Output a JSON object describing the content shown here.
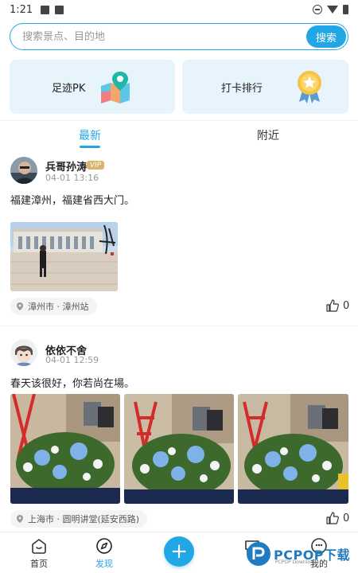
{
  "status_bar": {
    "time": "1:21"
  },
  "search": {
    "placeholder": "搜索景点、目的地",
    "button": "搜索"
  },
  "cards": {
    "footprint_pk": "足迹PK",
    "checkin_rank": "打卡排行"
  },
  "tabs": {
    "latest": "最新",
    "nearby": "附近"
  },
  "posts": [
    {
      "user": "兵哥孙涛",
      "vip": "VIP",
      "time": "04-01 13:16",
      "text": "福建漳州，福建省西大门。",
      "location": "漳州市 · 漳州站",
      "likes": "0"
    },
    {
      "user": "依依不舍",
      "time": "04-01 12:59",
      "text": "春天该很好，你若尚在場。",
      "location": "上海市 · 圆明讲堂(延安西路)",
      "likes": "0"
    }
  ],
  "bottom_nav": {
    "home": "首页",
    "discover": "发现",
    "add": "+",
    "message": "",
    "mine": "我的"
  },
  "colors": {
    "accent": "#22a7e6",
    "card_bg": "#e7f4fc",
    "vip": "#d9b46c"
  }
}
